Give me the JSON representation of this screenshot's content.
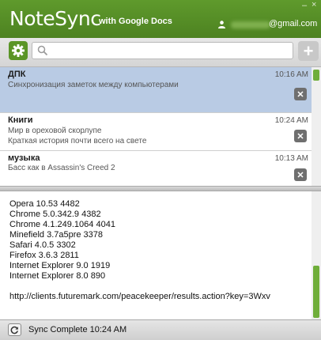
{
  "header": {
    "logo_main": "NoteSync",
    "logo_sub": "with Google Docs",
    "email": "@gmail.com",
    "minimize": "–",
    "close": "×"
  },
  "toolbar": {
    "search_placeholder": "",
    "add_label": "+"
  },
  "notes": [
    {
      "title": "ДПК",
      "lines": [
        "Синхронизация заметок между компьютерами"
      ],
      "time": "10:16 AM",
      "selected": true
    },
    {
      "title": "Книги",
      "lines": [
        "Мир в ореховой скорлупе",
        "Краткая история почти всего на свете"
      ],
      "time": "10:24 AM",
      "selected": false
    },
    {
      "title": "музыка",
      "lines": [
        "Басс как в Assassin's Creed 2"
      ],
      "time": "10:13 AM",
      "selected": false
    }
  ],
  "editor": {
    "lines": [
      "Opera 10.53 4482",
      "Chrome 5.0.342.9 4382",
      "Chrome 4.1.249.1064 4041",
      "Minefield 3.7a5pre 3378",
      "Safari 4.0.5 3302",
      "Firefox 3.6.3 2811",
      "Internet Explorer 9.0 1919",
      "Internet Explorer 8.0 890",
      "",
      "http://clients.futuremark.com/peacekeeper/results.action?key=3Wxv"
    ]
  },
  "status": {
    "text": "Sync Complete 10:24 AM"
  },
  "colors": {
    "brand_green": "#5a9526",
    "selected_row": "#b9cbe4"
  },
  "icons": {
    "settings": "gear-icon",
    "search": "search-icon",
    "add": "plus-icon",
    "delete": "close-icon",
    "sync": "refresh-icon",
    "user": "user-icon"
  }
}
